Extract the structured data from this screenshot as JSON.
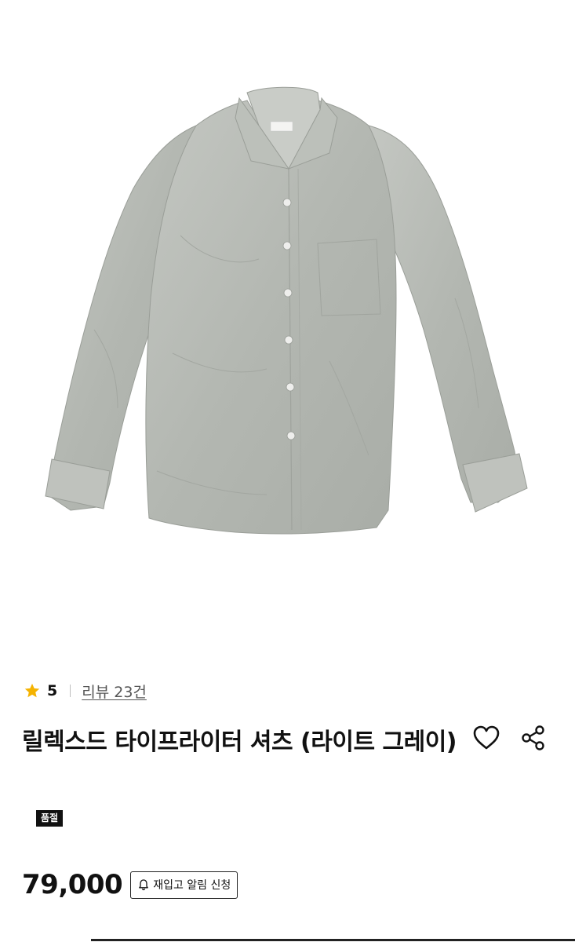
{
  "product": {
    "image_alt": "light gray button-up shirt",
    "rating": "5",
    "review_link": "리뷰 23건",
    "title": "릴렉스드 타이프라이터 셔츠 (라이트 그레이)",
    "badge": "품절",
    "price": "79,000",
    "restock_button": "재입고 알림 신청"
  },
  "icons": {
    "star": "star-icon",
    "heart": "heart-icon",
    "share": "share-icon",
    "bell": "bell-icon"
  },
  "colors": {
    "star": "#f5b301",
    "badge_bg": "#111111",
    "shirt": "#b6bab4"
  }
}
